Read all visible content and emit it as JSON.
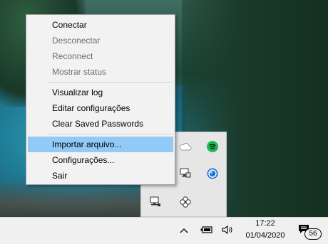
{
  "context_menu": {
    "items": [
      {
        "label": "Conectar",
        "enabled": true
      },
      {
        "label": "Desconectar",
        "enabled": false
      },
      {
        "label": "Reconnect",
        "enabled": false
      },
      {
        "label": "Mostrar status",
        "enabled": false
      },
      {
        "label": "Visualizar log",
        "enabled": true
      },
      {
        "label": "Editar configurações",
        "enabled": true
      },
      {
        "label": "Clear Saved Passwords",
        "enabled": true
      },
      {
        "label": "Importar arquivo...",
        "enabled": true,
        "highlighted": true
      },
      {
        "label": "Configurações...",
        "enabled": true
      },
      {
        "label": "Sair",
        "enabled": true
      }
    ]
  },
  "tray_overflow": {
    "icons": [
      "cloud-icon",
      "spotify-icon",
      "network-computer-icon",
      "blue-globe-icon",
      "openvpn-monitor-icon",
      "settings-flower-icon"
    ]
  },
  "taskbar": {
    "time": "17:22",
    "date": "01/04/2020",
    "notification_count": "56",
    "accent_color": "#91c9f7"
  }
}
